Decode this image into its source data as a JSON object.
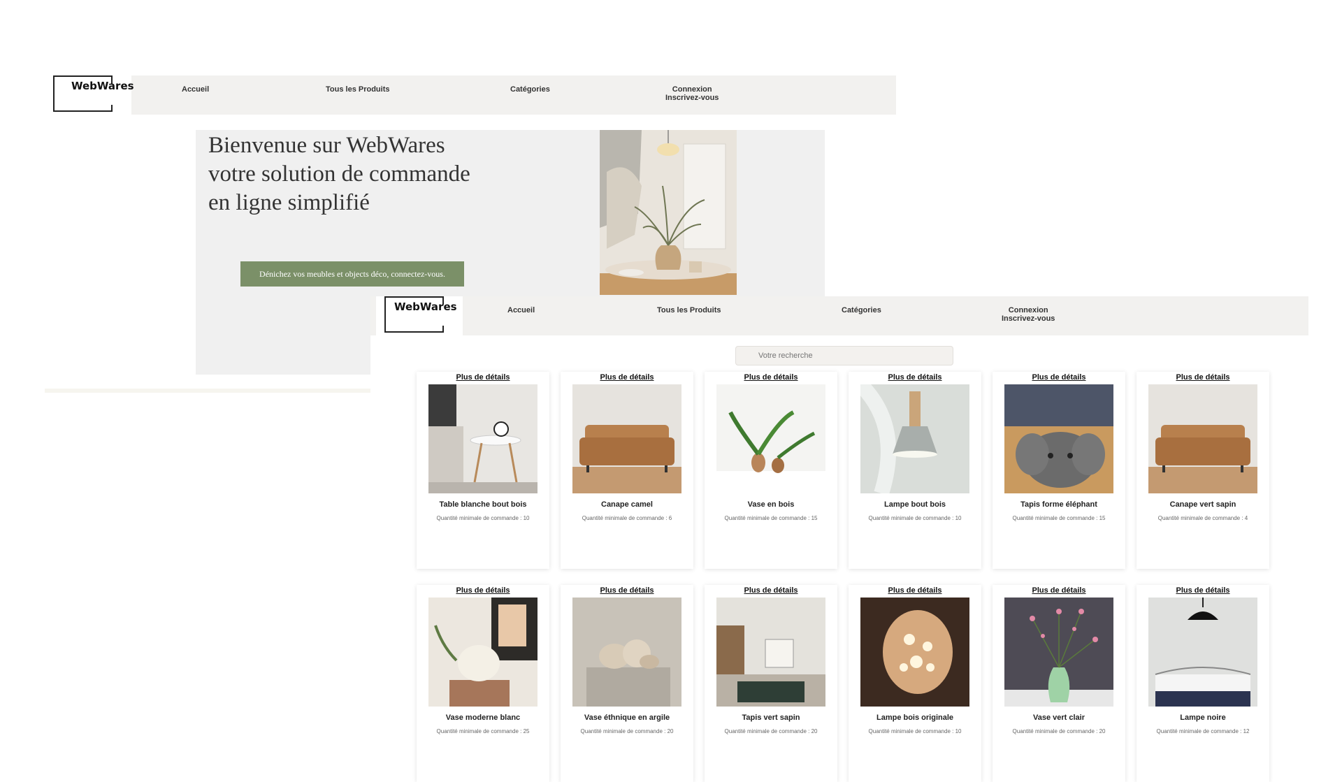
{
  "brand": "WebWares",
  "nav": {
    "home": "Accueil",
    "all_products": "Tous les Produits",
    "categories": "Catégories",
    "login": "Connexion",
    "signup": "Inscrivez-vous"
  },
  "hero": {
    "title_line1": "Bienvenue sur WebWares",
    "title_line2": "votre solution de commande",
    "title_line3": "en ligne simplifié",
    "cta": "Dénichez vos meubles et objects déco, connectez-vous."
  },
  "search": {
    "placeholder": "Votre recherche"
  },
  "details_label": "Plus de détails",
  "products": [
    {
      "name": "Table blanche bout bois",
      "qty": "Quantité minimale de commande : 10",
      "icon": "side-table"
    },
    {
      "name": "Canape camel",
      "qty": "Quantité minimale de commande : 6",
      "icon": "sofa"
    },
    {
      "name": "Vase en bois",
      "qty": "Quantité minimale de commande : 15",
      "icon": "vase-plant"
    },
    {
      "name": "Lampe bout bois",
      "qty": "Quantité minimale de commande : 10",
      "icon": "pendant-lamp"
    },
    {
      "name": "Tapis forme éléphant",
      "qty": "Quantité minimale de commande : 15",
      "icon": "rug"
    },
    {
      "name": "Canape vert sapin",
      "qty": "Quantité minimale de commande : 4",
      "icon": "sofa"
    },
    {
      "name": "Vase moderne blanc",
      "qty": "Quantité minimale de commande : 25",
      "icon": "vase"
    },
    {
      "name": "Vase éthnique en argile",
      "qty": "Quantité minimale de commande : 20",
      "icon": "vases"
    },
    {
      "name": "Tapis vert sapin",
      "qty": "Quantité minimale de commande : 20",
      "icon": "living-room"
    },
    {
      "name": "Lampe bois originale",
      "qty": "Quantité minimale de commande : 10",
      "icon": "wall-lamp"
    },
    {
      "name": "Vase vert clair",
      "qty": "Quantité minimale de commande : 20",
      "icon": "flower-vase"
    },
    {
      "name": "Lampe noire",
      "qty": "Quantité minimale de commande : 12",
      "icon": "black-lamp"
    }
  ],
  "colors": {
    "nav_bg": "#f2f1ef",
    "hero_bg": "#f0f0f0",
    "cta_bg": "#7b9068"
  }
}
